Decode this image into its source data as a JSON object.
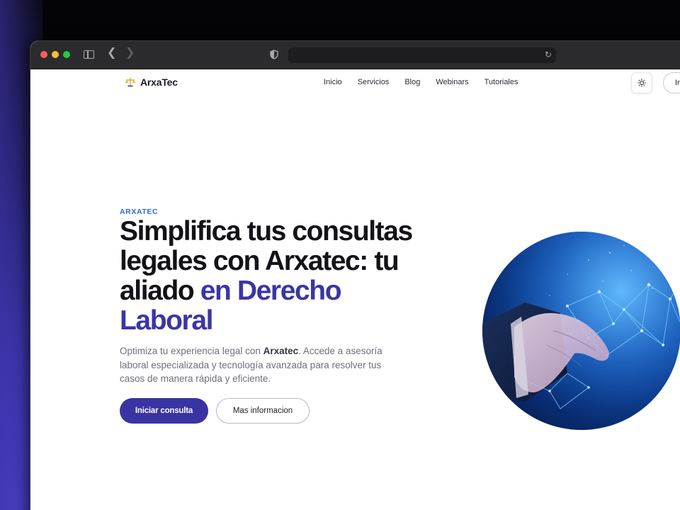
{
  "nav": {
    "logo_text": "ArxaTec",
    "links": [
      "Inicio",
      "Servicios",
      "Blog",
      "Webinars",
      "Tutoriales"
    ],
    "login_label": "In"
  },
  "hero": {
    "eyebrow": "ARXATEC",
    "title_main": "Simplifica tus consultas legales con Arxatec: tu aliado ",
    "title_accent": "en Derecho Laboral",
    "desc_before": "Optimiza tu experiencia legal con ",
    "desc_brand": "Arxatec",
    "desc_after": ". Accede a asesoría laboral especializada y tecnología avanzada para resolver tus casos de manera rápida y eficiente.",
    "primary_button": "Iniciar consulta",
    "secondary_button": "Mas informacion",
    "image_icon": "handshake-network-image"
  },
  "colors": {
    "accent": "#3b35a6",
    "eyebrow": "#2f6bdc",
    "browser_chrome": "#2b2b2e"
  }
}
